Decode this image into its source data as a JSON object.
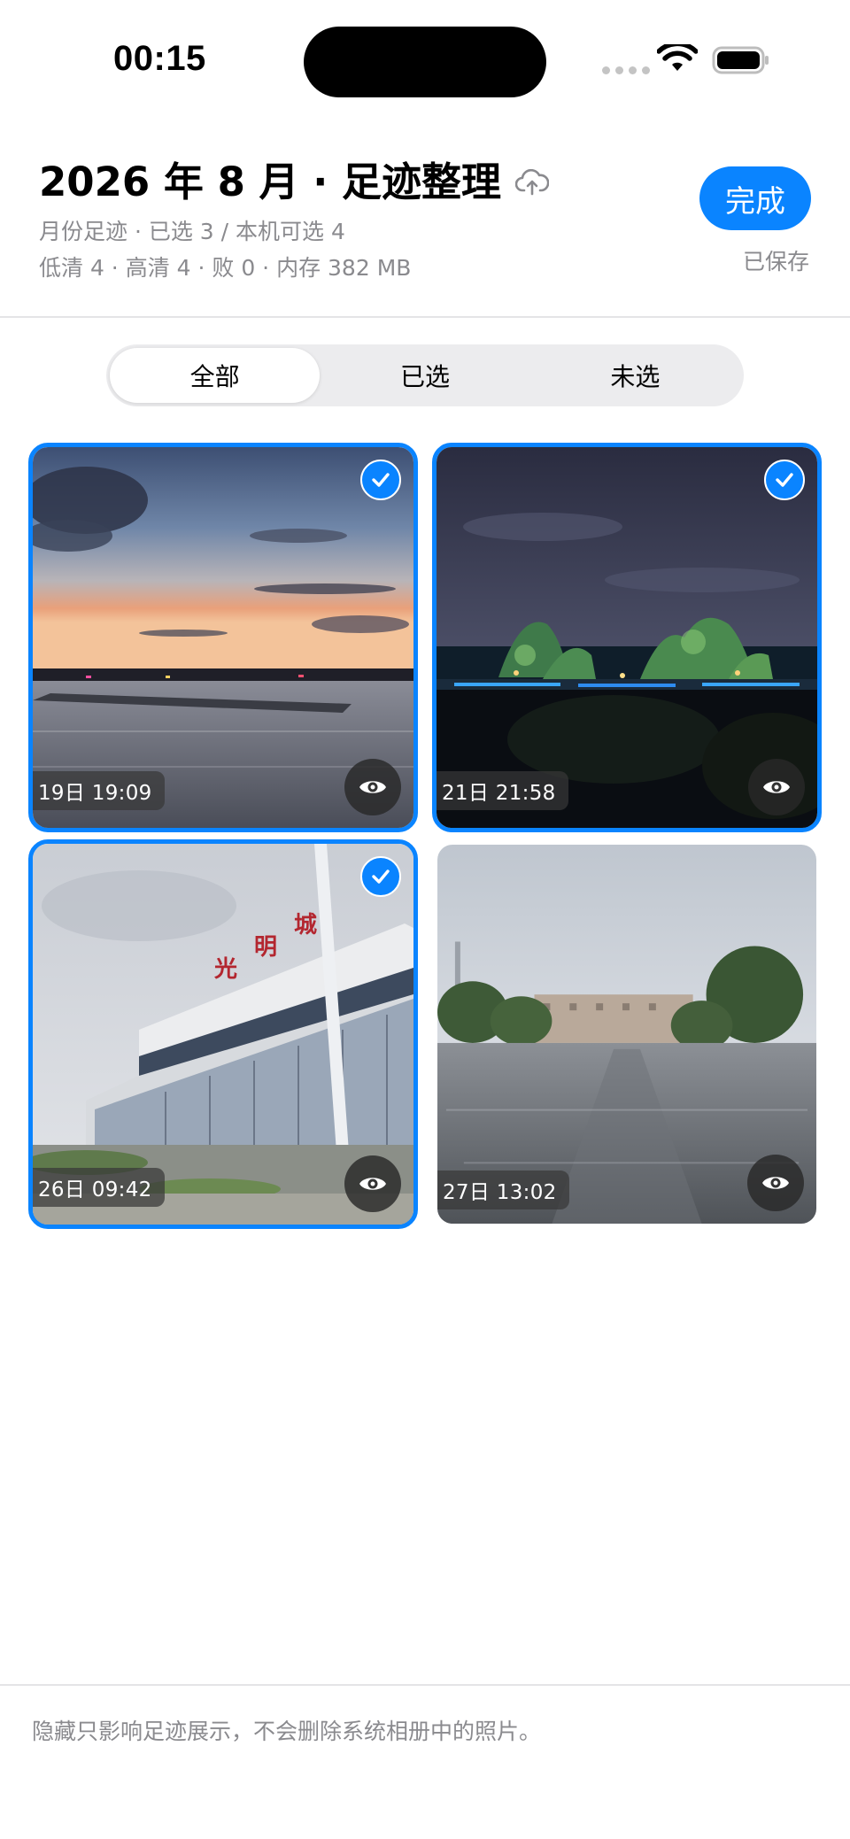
{
  "status_bar": {
    "time": "00:15",
    "icons": [
      "signal-dots-icon",
      "wifi-icon",
      "battery-icon"
    ]
  },
  "header": {
    "title": "2026 年 8 月 · 足迹整理",
    "title_icon": "cloud-upload-icon",
    "subtitle_line1": "月份足迹 · 已选 3 / 本机可选 4",
    "subtitle_line2": "低清 4 · 高清 4 · 败 0 · 内存 382 MB",
    "done_label": "完成",
    "saved_status": "已保存"
  },
  "filter_tabs": [
    {
      "label": "全部",
      "active": true
    },
    {
      "label": "已选",
      "active": false
    },
    {
      "label": "未选",
      "active": false
    }
  ],
  "photos": [
    {
      "timestamp": "19日 19:09",
      "selected": true,
      "scene": "sunset-lake"
    },
    {
      "timestamp": "21日 21:58",
      "selected": true,
      "scene": "night-karst-hills"
    },
    {
      "timestamp": "26日 09:42",
      "selected": true,
      "scene": "train-station-光明城"
    },
    {
      "timestamp": "27日 13:02",
      "selected": false,
      "scene": "rainy-street"
    }
  ],
  "photo_icons": {
    "selected": "checkmark-icon",
    "preview": "eye-icon"
  },
  "footer_note": "隐藏只影响足迹展示，不会删除系统相册中的照片。",
  "colors": {
    "accent": "#0a84ff",
    "secondary_text": "#8a8a8e",
    "segment_bg": "#ececee"
  }
}
